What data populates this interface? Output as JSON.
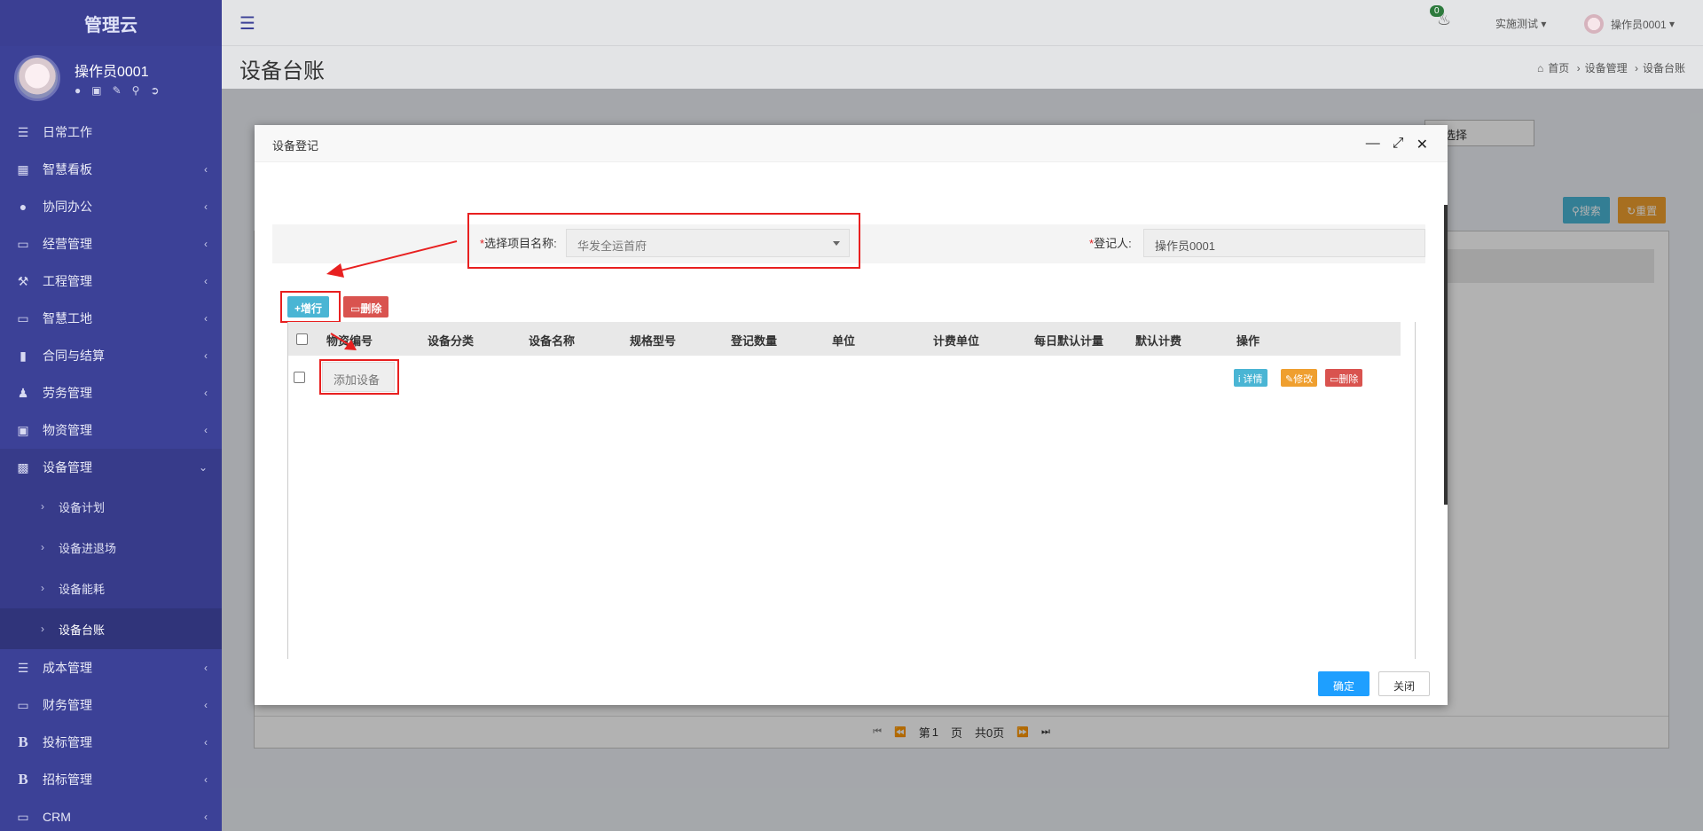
{
  "app": {
    "logo": "管理云"
  },
  "user": {
    "name": "操作员0001"
  },
  "sidebar": {
    "items": [
      {
        "label": "日常工作",
        "icon": "indent-icon"
      },
      {
        "label": "智慧看板",
        "icon": "dashboard-icon"
      },
      {
        "label": "协同办公",
        "icon": "users-icon"
      },
      {
        "label": "经营管理",
        "icon": "monitor-icon"
      },
      {
        "label": "工程管理",
        "icon": "hammer-icon"
      },
      {
        "label": "智慧工地",
        "icon": "monitor-icon"
      },
      {
        "label": "合同与结算",
        "icon": "file-icon"
      },
      {
        "label": "劳务管理",
        "icon": "worker-icon"
      },
      {
        "label": "物资管理",
        "icon": "cube-icon"
      },
      {
        "label": "设备管理",
        "icon": "cubes-icon"
      }
    ],
    "sub_items": [
      {
        "label": "设备计划"
      },
      {
        "label": "设备进退场"
      },
      {
        "label": "设备能耗"
      },
      {
        "label": "设备台账"
      }
    ],
    "items_after": [
      {
        "label": "成本管理",
        "icon": "list-icon"
      },
      {
        "label": "财务管理",
        "icon": "monitor-icon"
      },
      {
        "label": "投标管理",
        "icon": "bold-b-icon"
      },
      {
        "label": "招标管理",
        "icon": "bold-b-icon"
      },
      {
        "label": "CRM",
        "icon": "monitor-icon"
      }
    ]
  },
  "header": {
    "notification_count": "0",
    "tenant": "实施测试",
    "user": "操作员0001"
  },
  "page": {
    "title": "设备台账",
    "breadcrumb": [
      "首页",
      "设备管理",
      "设备台账"
    ]
  },
  "background": {
    "select_placeholder": "请选择",
    "search_label": "搜索",
    "reset_label": "重置",
    "pager": {
      "page_prefix": "第",
      "page_value": "1",
      "page_suffix": "页",
      "total": "共0页"
    }
  },
  "modal": {
    "title": "设备登记",
    "project_label": "选择项目名称:",
    "project_value": "华发全运首府",
    "registrant_label": "登记人:",
    "registrant_value": "操作员0001",
    "add_row_label": "增行",
    "delete_label": "删除",
    "columns": [
      "物资编号",
      "设备分类",
      "设备名称",
      "规格型号",
      "登记数量",
      "单位",
      "计费单位",
      "每日默认计量",
      "默认计费",
      "操作"
    ],
    "row": {
      "add_equipment_placeholder": "添加设备",
      "detail_label": "详情",
      "edit_label": "修改",
      "delete_label": "删除"
    },
    "confirm_label": "确定",
    "close_label": "关闭"
  }
}
